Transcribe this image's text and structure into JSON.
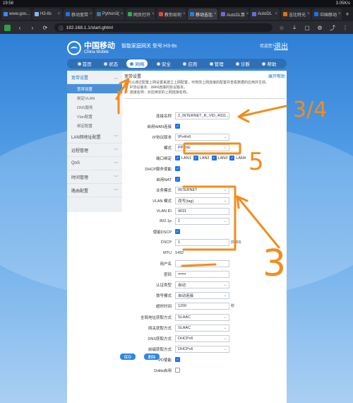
{
  "status_bar": {
    "time": "19:58",
    "net": "3.05K/s",
    "battery": ""
  },
  "browser": {
    "tabs": [
      {
        "label": "www.goo...",
        "color": "#4285f4",
        "active": false
      },
      {
        "label": "H3-8s",
        "color": "#8ab4f8",
        "active": false
      },
      {
        "label": "移动宽带",
        "color": "#1a73e8",
        "active": false
      },
      {
        "label": "Python3(",
        "color": "#3776ab",
        "active": false
      },
      {
        "label": "网页打开",
        "color": "#34a853",
        "active": false
      },
      {
        "label": "教你如何",
        "color": "#ea4335",
        "active": false
      },
      {
        "label": "移动吉比",
        "color": "#2a7ae2",
        "active": true
      },
      {
        "label": "AutoDL算",
        "color": "#6b6bd6",
        "active": false
      },
      {
        "label": "AutoDL",
        "color": "#6b6bd6",
        "active": false
      },
      {
        "label": "吉比特光",
        "color": "#e8710a",
        "active": false
      },
      {
        "label": "中国移动",
        "color": "#1a73e8",
        "active": false
      }
    ],
    "url": "192.168.1.1/start.ghtml"
  },
  "header": {
    "logo_cn": "中国移动",
    "logo_en": "China Mobile",
    "device_title": "智能家庭网关 型号:H3-8s",
    "welcome": "欢迎您！",
    "logout": "退出"
  },
  "nav": [
    {
      "label": "首页",
      "active": false
    },
    {
      "label": "状态",
      "active": false
    },
    {
      "label": "网络",
      "active": true
    },
    {
      "label": "安全",
      "active": false
    },
    {
      "label": "应用",
      "active": false
    },
    {
      "label": "管理",
      "active": false
    },
    {
      "label": "诊断",
      "active": false
    },
    {
      "label": "帮助",
      "active": false
    }
  ],
  "sidebar": {
    "groups": [
      {
        "label": "宽带设置",
        "open": true,
        "subs": [
          {
            "label": "宽带设置",
            "active": true
          },
          {
            "label": "绑定VLAN",
            "active": false
          },
          {
            "label": "DNS服务",
            "active": false
          },
          {
            "label": "Vlan配置",
            "active": false
          },
          {
            "label": "绑定配置",
            "active": false
          }
        ]
      },
      {
        "label": "LAN侧地址配置",
        "open": false,
        "subs": []
      },
      {
        "label": "远程管理",
        "open": false,
        "subs": []
      },
      {
        "label": "QoS",
        "open": false,
        "subs": []
      },
      {
        "label": "时间管理",
        "open": false,
        "subs": []
      },
      {
        "label": "路由配置",
        "open": false,
        "subs": []
      }
    ]
  },
  "panel": {
    "title": "宽带设置",
    "help": "展开帮助",
    "desc": [
      "您可以通过配置上网设置来建立上网配置，可修改上网连接的配置并查看数据的应用并生效。",
      "1）IP协议版本：WAN连接的协议版本。",
      "2）连接名称：对应绑定的上网连接名称。"
    ]
  },
  "form": {
    "connection_name": {
      "label": "连接名称",
      "value": "2_INTERNET_R_VID_4031"
    },
    "enable_wan": {
      "label": "启用WAN连接",
      "checked": true
    },
    "ip_version": {
      "label": "IP协议版本",
      "value": "IPv4/v6"
    },
    "mode": {
      "label": "模式",
      "value": "PPPoE"
    },
    "port_binding": {
      "label": "端口绑定",
      "ports": [
        {
          "label": "LAN1",
          "checked": true
        },
        {
          "label": "LAN2",
          "checked": true
        },
        {
          "label": "LAN3",
          "checked": true
        },
        {
          "label": "LAN4",
          "checked": true
        }
      ]
    },
    "dhcp_server": {
      "label": "DHCP服务使能",
      "checked": true
    },
    "nat": {
      "label": "启用NAT",
      "checked": true
    },
    "service_mode": {
      "label": "业务模式",
      "value": "INTERNET"
    },
    "vlan_mode": {
      "label": "VLAN 模式",
      "value": "改写(tag)"
    },
    "vlan_id": {
      "label": "VLAN ID",
      "value": "4031"
    },
    "p8021": {
      "label": "802.1p",
      "value": "1"
    },
    "dscp_enable": {
      "label": "使能DSCP",
      "checked": true
    },
    "dscp": {
      "label": "DSCP",
      "value": "1",
      "range": "(0~63)"
    },
    "mtu": {
      "label": "MTU",
      "value": "1492"
    },
    "username": {
      "label": "用户名",
      "value": ""
    },
    "password": {
      "label": "密码",
      "value": "••••••"
    },
    "auth_type": {
      "label": "认证类型",
      "value": "自动"
    },
    "dial_mode": {
      "label": "拨号模式",
      "value": "自动连接"
    },
    "timeout": {
      "label": "超时时间",
      "value": "1200",
      "suffix": "秒"
    },
    "global_addr": {
      "label": "全局地址获取方式",
      "value": "SLAAC"
    },
    "gateway_mode": {
      "label": "网关获取方式",
      "value": "SLAAC"
    },
    "dns_mode": {
      "label": "DNS获取方式",
      "value": "DHCPv6"
    },
    "prefix_mode": {
      "label": "前缀获取方式",
      "value": "DHCPv6"
    },
    "pd": {
      "label": "PD使能",
      "checked": true
    },
    "dslite": {
      "label": "Dslite启用",
      "checked": false
    }
  },
  "buttons": {
    "save": "保存",
    "delete": "删除"
  },
  "annotations": {
    "a1": "3/4",
    "a2": "5",
    "a3": "3",
    "color": "#f28c1e"
  }
}
